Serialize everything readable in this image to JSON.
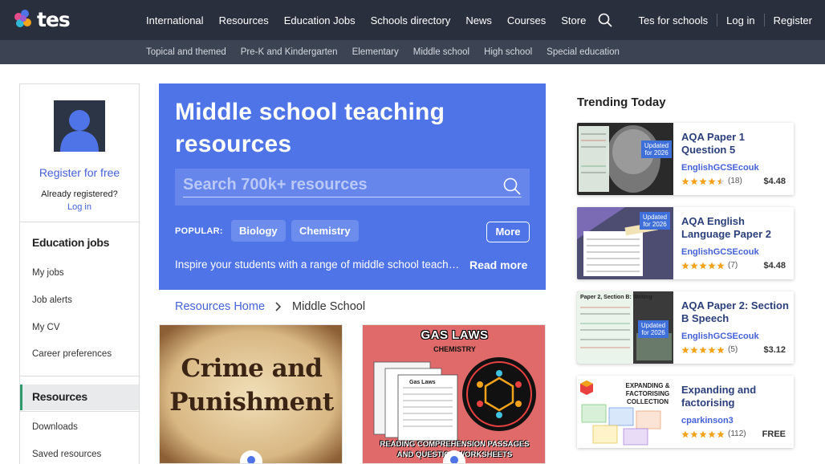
{
  "brand": {
    "logo_text": "tes"
  },
  "main_nav": [
    "International",
    "Resources",
    "Education Jobs",
    "Schools directory",
    "News",
    "Courses",
    "Store"
  ],
  "right_nav": {
    "schools": "Tes for schools",
    "login": "Log in",
    "register": "Register"
  },
  "sub_nav": [
    "Topical and themed",
    "Pre-K and Kindergarten",
    "Elementary",
    "Middle school",
    "High school",
    "Special education"
  ],
  "sidebar": {
    "register_label": "Register for free",
    "already_label": "Already registered?",
    "login_label": "Log in",
    "jobs_heading": "Education jobs",
    "jobs_items": [
      "My jobs",
      "Job alerts",
      "My CV",
      "Career preferences"
    ],
    "resources_heading": "Resources",
    "resources_items": [
      "Downloads",
      "Saved resources"
    ]
  },
  "hero": {
    "title": "Middle school teaching resources",
    "search_placeholder": "Search 700k+ resources",
    "popular_label": "POPULAR:",
    "popular_pills": [
      "Biology",
      "Chemistry"
    ],
    "more_label": "More",
    "description": "Inspire your students with a range of middle school teaching resources",
    "read_more": "Read more"
  },
  "breadcrumb": {
    "home": "Resources Home",
    "current": "Middle School"
  },
  "cards": [
    {
      "line1": "Crime and",
      "line2": "Punishment"
    },
    {
      "title": "GAS LAWS",
      "subtitle": "CHEMISTRY",
      "sheet_label": "Gas Laws",
      "bottom_line1": "READING COMPREHENSION PASSAGES",
      "bottom_line2": "AND QUESTION WORKSHEETS"
    }
  ],
  "trending": {
    "title": "Trending Today",
    "items": [
      {
        "title": "AQA Paper 1 Question 5",
        "author": "EnglishGCSEcouk",
        "rating": 4.5,
        "count": "(18)",
        "price": "$4.48",
        "badge": "Updated for 2026"
      },
      {
        "title": "AQA English Language Paper 2",
        "author": "EnglishGCSEcouk",
        "rating": 5,
        "count": "(7)",
        "price": "$4.48",
        "badge": "Updated for 2026"
      },
      {
        "title": "AQA Paper 2: Section B Speech",
        "author": "EnglishGCSEcouk",
        "rating": 5,
        "count": "(5)",
        "price": "$3.12",
        "badge": "Updated for 2026",
        "thumb_heading": "Paper 2, Section B: Writing"
      },
      {
        "title": "Expanding and factorising",
        "author": "cparkinson3",
        "rating": 5,
        "count": "(112)",
        "price": "FREE",
        "thumb_heading": "EXPANDING & FACTORISING COLLECTION"
      }
    ]
  },
  "colors": {
    "topbar": "#2a2f3d",
    "subbar": "#3c4353",
    "hero": "#4f74e7",
    "link": "#4561d8",
    "star": "#f2a31b",
    "active_marker": "#2e9a6e"
  }
}
